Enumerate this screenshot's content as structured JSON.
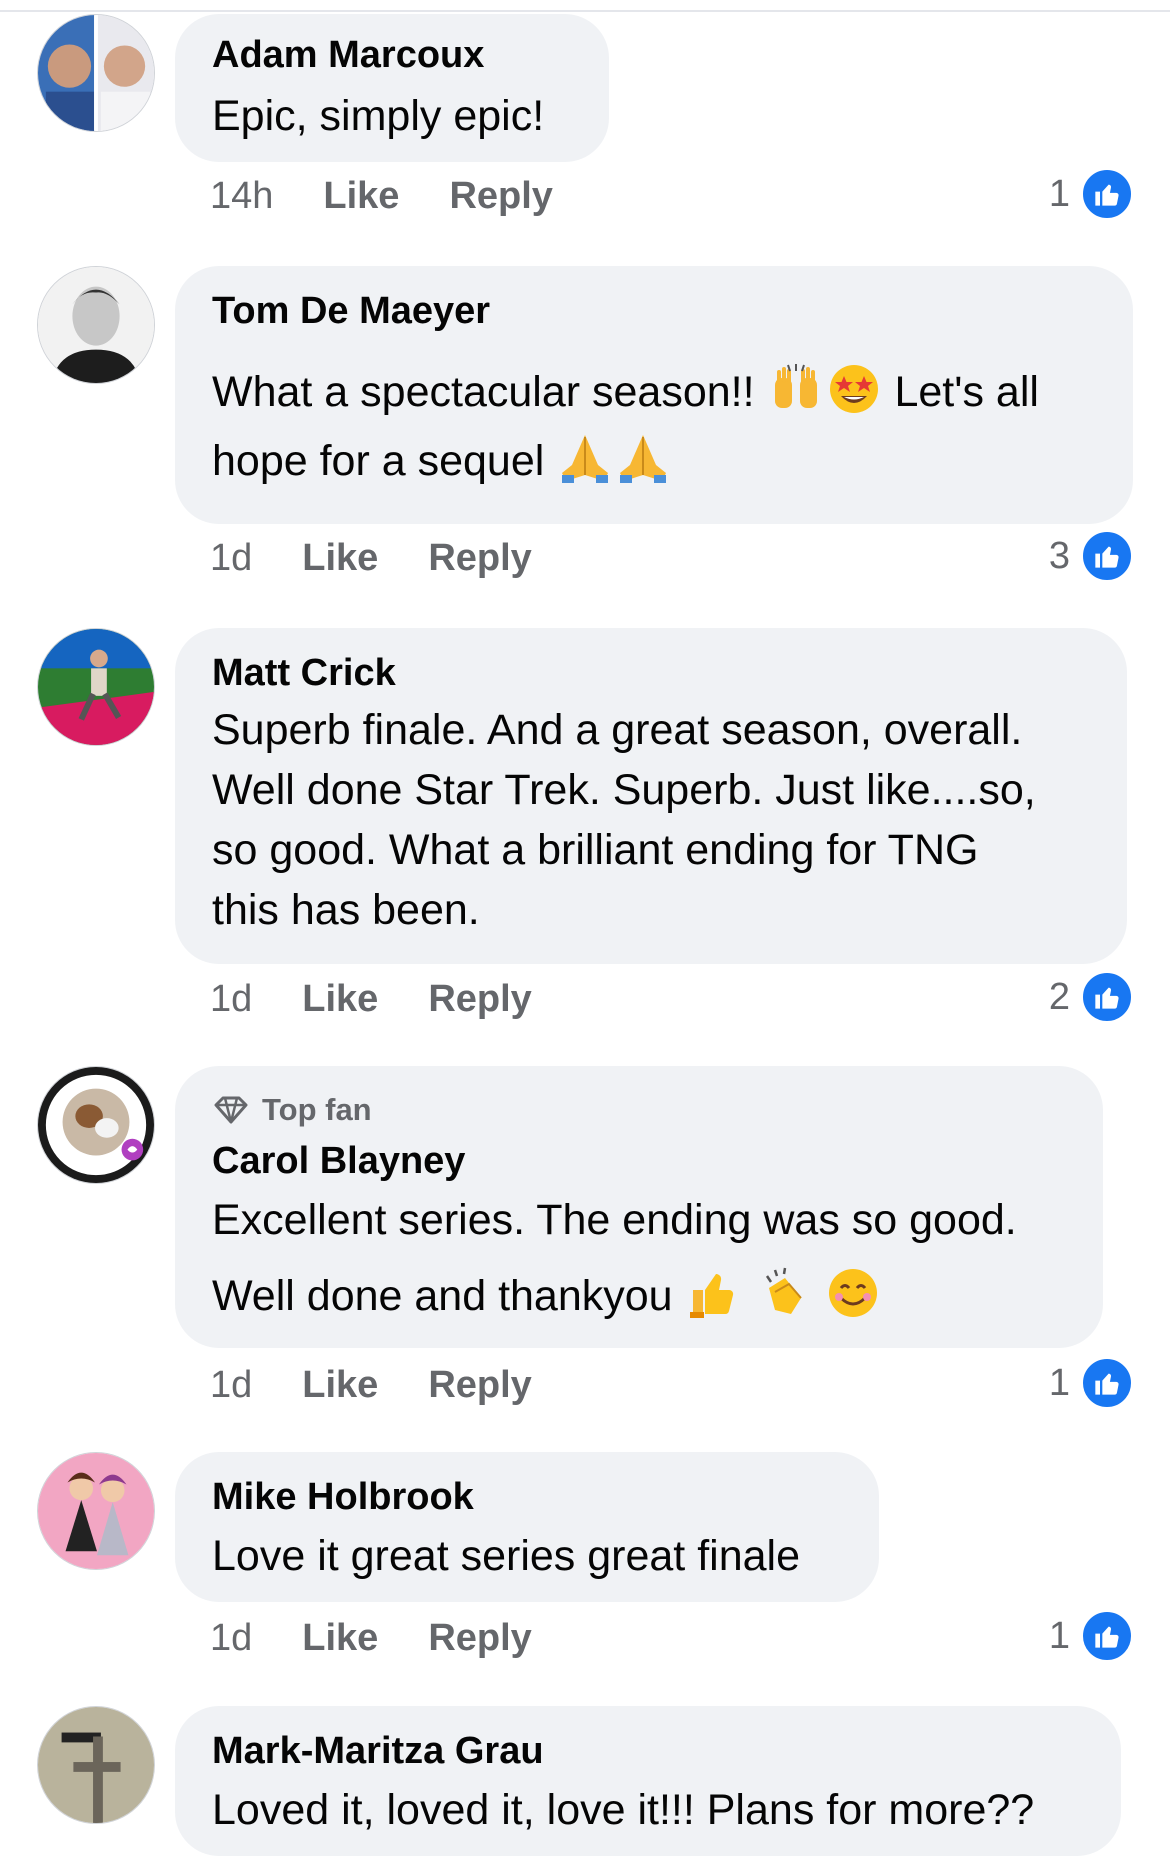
{
  "comments": [
    {
      "author": "Adam Marcoux",
      "lines": [
        "Epic, simply epic!"
      ],
      "time": "14h",
      "like": "Like",
      "reply": "Reply",
      "reactions": "1"
    },
    {
      "author": "Tom De Maeyer",
      "line1a": "What a spectacular season!!",
      "line1b": "Let's all",
      "line2": "hope for a sequel",
      "emojis": [
        "raising-hands",
        "star-struck",
        "folded-hands",
        "folded-hands"
      ],
      "time": "1d",
      "like": "Like",
      "reply": "Reply",
      "reactions": "3"
    },
    {
      "author": "Matt Crick",
      "lines": [
        "Superb finale. And a great season, overall.",
        "Well done Star Trek. Superb. Just like....so,",
        "so good. What a brilliant ending for TNG",
        "this has been."
      ],
      "time": "1d",
      "like": "Like",
      "reply": "Reply",
      "reactions": "2"
    },
    {
      "badge": "Top fan",
      "author": "Carol Blayney",
      "line1": "Excellent series. The ending was so good.",
      "line2": "Well done and thankyou",
      "emojis": [
        "thumbs-up",
        "clapping-hands",
        "smiling-face"
      ],
      "time": "1d",
      "like": "Like",
      "reply": "Reply",
      "reactions": "1"
    },
    {
      "author": "Mike Holbrook",
      "lines": [
        "Love it great series great finale"
      ],
      "time": "1d",
      "like": "Like",
      "reply": "Reply",
      "reactions": "1"
    },
    {
      "author": "Mark-Maritza Grau",
      "lines": [
        "Loved it, loved it, love it!!! Plans for more??"
      ]
    }
  ],
  "colors": {
    "like_blue": "#1877f2",
    "bubble": "#f0f2f5",
    "meta_gray": "#65676b"
  }
}
